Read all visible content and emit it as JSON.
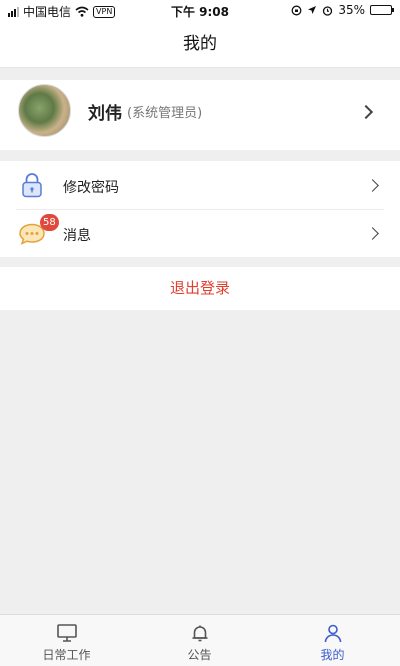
{
  "status_bar": {
    "carrier": "中国电信",
    "vpn": "VPN",
    "time": "下午 9:08",
    "battery": "35%",
    "battery_level": 0.35
  },
  "nav": {
    "title": "我的"
  },
  "profile": {
    "name": "刘伟",
    "role": "(系统管理员)"
  },
  "menu": [
    {
      "label": "修改密码",
      "icon": "lock-icon"
    },
    {
      "label": "消息",
      "icon": "chat-bubble-icon",
      "badge": "58"
    }
  ],
  "logout": {
    "label": "退出登录"
  },
  "tabs": [
    {
      "label": "日常工作",
      "icon": "monitor-icon"
    },
    {
      "label": "公告",
      "icon": "bell-icon"
    },
    {
      "label": "我的",
      "icon": "person-icon",
      "active": true
    }
  ],
  "colors": {
    "accent": "#3b5bcf",
    "danger": "#e0402f",
    "badge": "#e0493c"
  }
}
